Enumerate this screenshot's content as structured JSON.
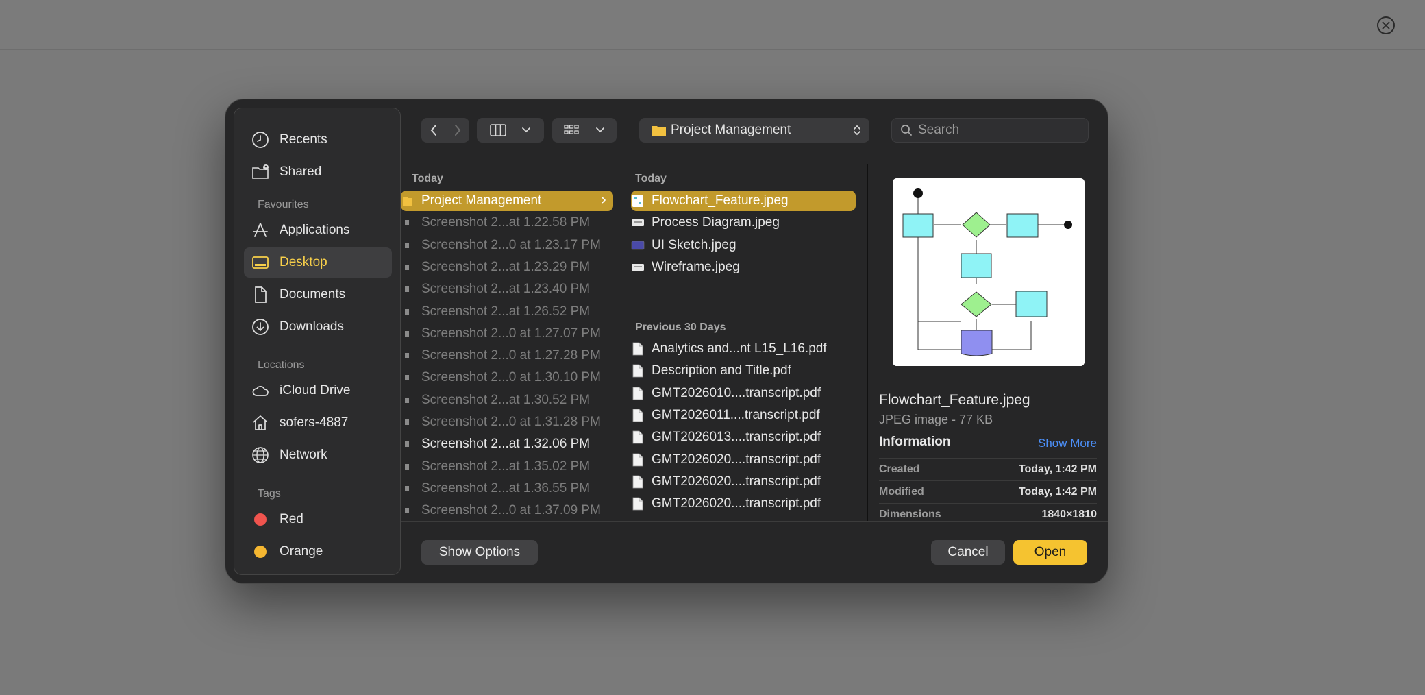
{
  "sidebar": {
    "items_top": [
      {
        "label": "Recents",
        "icon": "clock-icon"
      },
      {
        "label": "Shared",
        "icon": "shared-folder-icon"
      }
    ],
    "favourites_header": "Favourites",
    "favourites": [
      {
        "label": "Applications",
        "icon": "applications-icon"
      },
      {
        "label": "Desktop",
        "icon": "desktop-icon",
        "selected": true
      },
      {
        "label": "Documents",
        "icon": "document-icon"
      },
      {
        "label": "Downloads",
        "icon": "download-icon"
      }
    ],
    "locations_header": "Locations",
    "locations": [
      {
        "label": "iCloud Drive",
        "icon": "cloud-icon"
      },
      {
        "label": "sofers-4887",
        "icon": "home-icon"
      },
      {
        "label": "Network",
        "icon": "globe-icon"
      }
    ],
    "tags_header": "Tags",
    "tags": [
      {
        "label": "Red",
        "color": "#f0544e"
      },
      {
        "label": "Orange",
        "color": "#f5b731"
      }
    ]
  },
  "toolbar": {
    "path_label": "Project Management",
    "search_placeholder": "Search"
  },
  "column1": {
    "header": "Today",
    "items": [
      {
        "label": "Project Management",
        "selected": true
      },
      {
        "label": "Screenshot 2...at 1.22.58 PM",
        "dim": true
      },
      {
        "label": "Screenshot 2...0 at 1.23.17 PM",
        "dim": true
      },
      {
        "label": "Screenshot 2...at 1.23.29 PM",
        "dim": true
      },
      {
        "label": "Screenshot 2...at 1.23.40 PM",
        "dim": true
      },
      {
        "label": "Screenshot 2...at 1.26.52 PM",
        "dim": true
      },
      {
        "label": "Screenshot 2...0 at 1.27.07 PM",
        "dim": true
      },
      {
        "label": "Screenshot 2...0 at 1.27.28 PM",
        "dim": true
      },
      {
        "label": "Screenshot 2...0 at 1.30.10 PM",
        "dim": true
      },
      {
        "label": "Screenshot 2...at 1.30.52 PM",
        "dim": true
      },
      {
        "label": "Screenshot 2...0 at 1.31.28 PM",
        "dim": true
      },
      {
        "label": "Screenshot 2...at 1.32.06 PM",
        "dim": false
      },
      {
        "label": "Screenshot 2...at 1.35.02 PM",
        "dim": true
      },
      {
        "label": "Screenshot 2...at 1.36.55 PM",
        "dim": true
      },
      {
        "label": "Screenshot 2...0 at 1.37.09 PM",
        "dim": true
      }
    ]
  },
  "column2": {
    "header_today": "Today",
    "today": [
      {
        "label": "Flowchart_Feature.jpeg",
        "selected": true
      },
      {
        "label": "Process Diagram.jpeg"
      },
      {
        "label": "UI Sketch.jpeg"
      },
      {
        "label": "Wireframe.jpeg"
      }
    ],
    "header_prev": "Previous 30 Days",
    "previous": [
      {
        "label": "Analytics and...nt L15_L16.pdf"
      },
      {
        "label": "Description and Title.pdf"
      },
      {
        "label": "GMT2026010....transcript.pdf"
      },
      {
        "label": "GMT2026011....transcript.pdf"
      },
      {
        "label": "GMT2026013....transcript.pdf"
      },
      {
        "label": "GMT2026020....transcript.pdf"
      },
      {
        "label": "GMT2026020....transcript.pdf"
      },
      {
        "label": "GMT2026020....transcript.pdf"
      }
    ]
  },
  "preview": {
    "name": "Flowchart_Feature.jpeg",
    "kind": "JPEG image - 77 KB",
    "info_header": "Information",
    "show_more": "Show More",
    "meta": [
      {
        "key": "Created",
        "value": "Today, 1:42 PM"
      },
      {
        "key": "Modified",
        "value": "Today, 1:42 PM"
      },
      {
        "key": "Dimensions",
        "value": "1840×1810"
      }
    ]
  },
  "buttons": {
    "show_options": "Show Options",
    "cancel": "Cancel",
    "open": "Open"
  },
  "colors": {
    "accent_yellow": "#f5c330",
    "selection": "#c29a2c",
    "link_blue": "#4c8ff7"
  }
}
